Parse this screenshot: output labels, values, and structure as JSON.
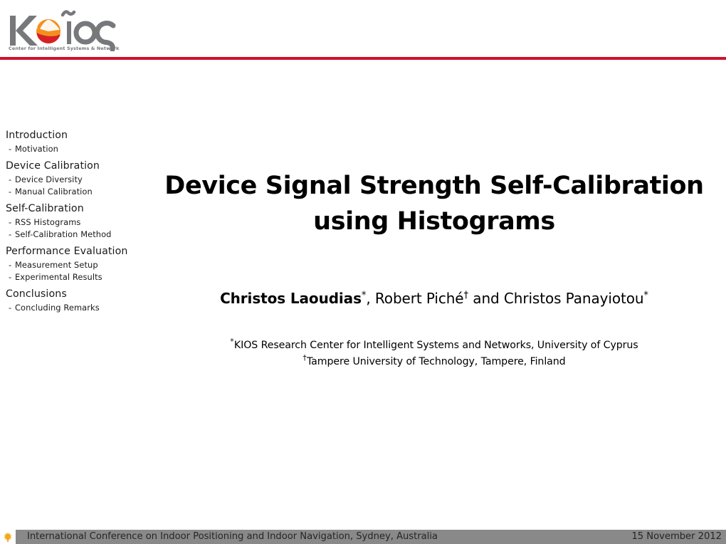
{
  "header": {
    "logo": {
      "wordmark": "ΚΏΙΟΣ",
      "tagline": "Center for Intelligent Systems & Networks",
      "colors": {
        "letters": "#77787b",
        "sphere_orange": "#f3901d",
        "sphere_red": "#d62027",
        "rule": "#d1102a"
      }
    }
  },
  "sidebar": {
    "sections": [
      {
        "label": "Introduction",
        "items": [
          {
            "dash": "-",
            "label": "Motivation"
          }
        ]
      },
      {
        "label": "Device Calibration",
        "items": [
          {
            "dash": "-",
            "label": "Device Diversity"
          },
          {
            "dash": "-",
            "label": "Manual Calibration"
          }
        ]
      },
      {
        "label": "Self-Calibration",
        "items": [
          {
            "dash": "-",
            "label": "RSS Histograms"
          },
          {
            "dash": "-",
            "label": "Self-Calibration Method"
          }
        ]
      },
      {
        "label": "Performance Evaluation",
        "items": [
          {
            "dash": "-",
            "label": "Measurement Setup"
          },
          {
            "dash": "-",
            "label": "Experimental Results"
          }
        ]
      },
      {
        "label": "Conclusions",
        "items": [
          {
            "dash": "-",
            "label": "Concluding Remarks"
          }
        ]
      }
    ]
  },
  "main": {
    "title_line1": "Device Signal Strength Self-Calibration",
    "title_line2": "using Histograms",
    "authors": {
      "author1_name": "Christos Laoudias",
      "author1_mark": "*",
      "separator1": ", ",
      "author2_name": "Robert Piché",
      "author2_mark": "†",
      "separator2": " and ",
      "author3_name": "Christos Panayiotou",
      "author3_mark": "*"
    },
    "affiliations": [
      {
        "mark": "*",
        "text": "KIOS Research Center for Intelligent Systems and Networks, University of Cyprus"
      },
      {
        "mark": "†",
        "text": "Tampere University of Technology, Tampere, Finland"
      }
    ]
  },
  "footer": {
    "icon": "tree-icon",
    "left_text": "International Conference on Indoor Positioning and Indoor Navigation, Sydney, Australia",
    "right_text": "15 November 2012",
    "bar_color": "#898989"
  }
}
